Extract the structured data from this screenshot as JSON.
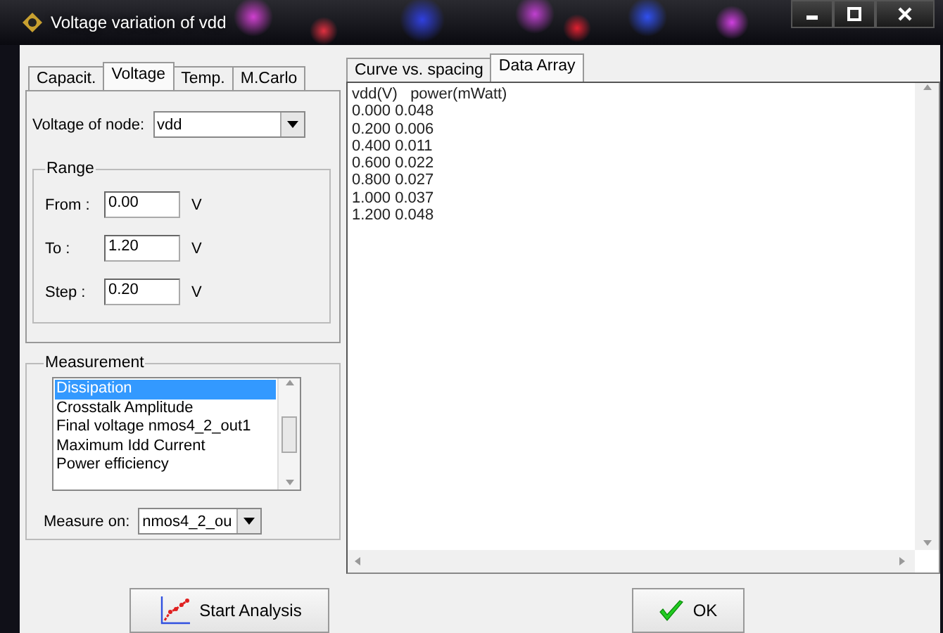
{
  "window": {
    "title": "Voltage variation of vdd"
  },
  "left_tabs": [
    {
      "label": "Capacit.",
      "selected": false
    },
    {
      "label": "Voltage",
      "selected": true
    },
    {
      "label": "Temp.",
      "selected": false
    },
    {
      "label": "M.Carlo",
      "selected": false
    }
  ],
  "voltage_tab": {
    "node_label": "Voltage of node:",
    "node_value": "vdd",
    "range": {
      "title": "Range",
      "fields": [
        {
          "label": "From :",
          "value": "0.00",
          "unit": "V"
        },
        {
          "label": "To :",
          "value": "1.20",
          "unit": "V"
        },
        {
          "label": "Step :",
          "value": "0.20",
          "unit": "V"
        }
      ]
    }
  },
  "measurement": {
    "title": "Measurement",
    "items": [
      {
        "label": "Dissipation",
        "selected": true
      },
      {
        "label": "Crosstalk Amplitude",
        "selected": false
      },
      {
        "label": "Final voltage  nmos4_2_out1",
        "selected": false
      },
      {
        "label": "Maximum Idd Current",
        "selected": false
      },
      {
        "label": "Power efficiency",
        "selected": false
      }
    ],
    "measure_on_label": "Measure on:",
    "measure_on_value": "nmos4_2_ou"
  },
  "right_tabs": [
    {
      "label": "Curve vs. spacing",
      "selected": false
    },
    {
      "label": "Data Array",
      "selected": true
    }
  ],
  "data_array": {
    "lines": [
      "vdd(V)   power(mWatt)",
      "0.000 0.048",
      "0.200 0.006",
      "0.400 0.011",
      "0.600 0.022",
      "0.800 0.027",
      "1.000 0.037",
      "1.200 0.048"
    ]
  },
  "buttons": [
    {
      "label": "Start Analysis",
      "kind": "chart"
    },
    {
      "label": "OK",
      "kind": "check"
    }
  ]
}
